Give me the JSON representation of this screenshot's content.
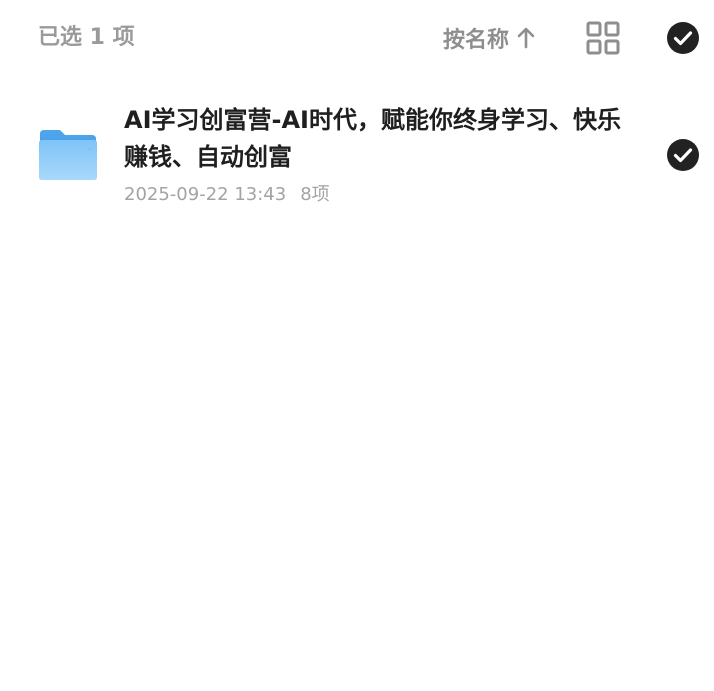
{
  "toolbar": {
    "selection_label": "已选 1 项",
    "sort_label": "按名称",
    "sort_direction_icon": "arrow-up-icon",
    "view_toggle_icon": "grid-view-icon",
    "select_all_icon": "check-circle-icon",
    "select_all_checked": true
  },
  "files": [
    {
      "name": "AI学习创富营-AI时代，赋能你终身学习、快乐赚钱、自动创富",
      "date": "2025-09-22 13:43",
      "count": "8项",
      "type_icon": "folder-icon",
      "selected": true
    }
  ],
  "colors": {
    "muted_text": "#9a9a9a",
    "primary_text": "#1f1f1f",
    "check_fill": "#222222",
    "folder_blue": "#5aaef0"
  }
}
